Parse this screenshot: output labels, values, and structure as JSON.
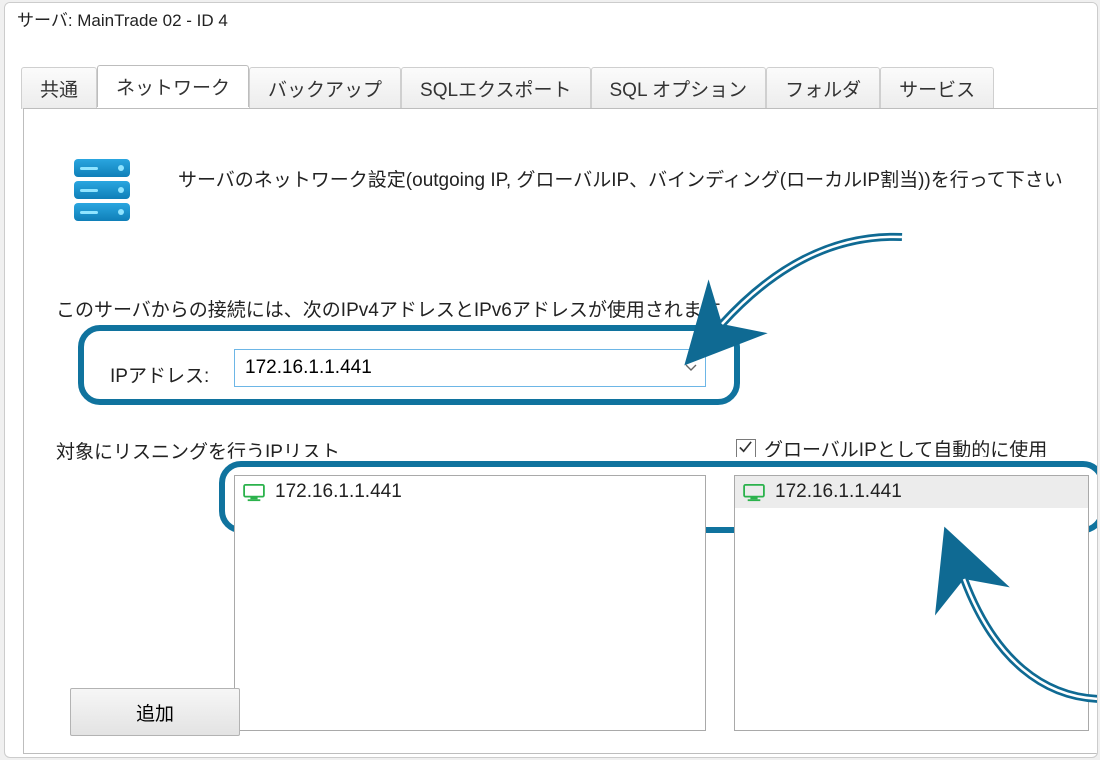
{
  "window": {
    "title": "サーバ: MainTrade 02 - ID 4"
  },
  "tabs": {
    "items": [
      {
        "label": "共通"
      },
      {
        "label": "ネットワーク",
        "active": true
      },
      {
        "label": "バックアップ"
      },
      {
        "label": "SQLエクスポート"
      },
      {
        "label": "SQL オプション"
      },
      {
        "label": "フォルダ"
      },
      {
        "label": "サービス"
      }
    ]
  },
  "description": "サーバのネットワーク設定(outgoing IP, グローバルIP、バインディング(ローカルIP割当))を行って下さい",
  "section": {
    "subhead": "このサーバからの接続には、次のIPv4アドレスとIPv6アドレスが使用されます",
    "ip_label": "IPアドレス:",
    "ip_value": "172.16.1.1.441",
    "listening_label": "対象にリスニングを行うIPリスト",
    "global_checkbox": {
      "label": "グローバルIPとして自動的に使用",
      "checked": true
    },
    "left_list": [
      {
        "ip": "172.16.1.1.441"
      }
    ],
    "right_list": [
      {
        "ip": "172.16.1.1.441"
      }
    ],
    "add_button": "追加"
  },
  "icons": {
    "server": "server-stack-icon",
    "chevron_down": "chevron-down-icon",
    "monitor": "monitor-icon",
    "checkmark": "checkmark-icon",
    "annotation_arrow": "curved-arrow-icon"
  },
  "colors": {
    "highlight_border": "#10739e",
    "tab_active_bg": "#ffffff",
    "combo_border": "#6db6e6",
    "monitor_green": "#2bb24c",
    "arrow": "#0f6a93"
  }
}
